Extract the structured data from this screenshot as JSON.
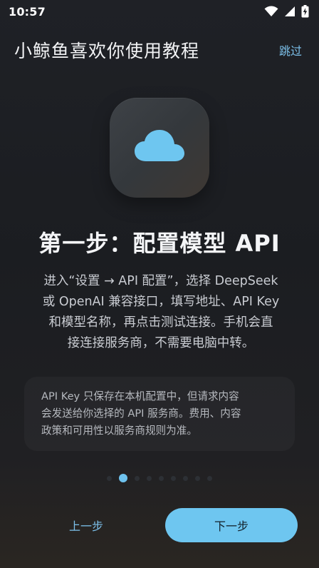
{
  "status_bar": {
    "time": "10:57",
    "icons": [
      "wifi-icon",
      "signal-icon",
      "battery-charging-icon"
    ]
  },
  "header": {
    "title": "小鲸鱼喜欢你使用教程",
    "skip_label": "跳过"
  },
  "hero": {
    "icon": "cloud-icon",
    "icon_color": "#6ec6f0"
  },
  "step": {
    "title": "第一步：配置模型 API",
    "description_lines": [
      "进入“设置 → API 配置”，选择 DeepSeek",
      "或 OpenAI 兼容接口，填写地址、API Key",
      "和模型名称，再点击测试连接。手机会直",
      "接连接服务商，不需要电脑中转。"
    ]
  },
  "notice": {
    "lines": [
      "API Key 只保存在本机配置中，但请求内容",
      "会发送给你选择的 API 服务商。费用、内容",
      "政策和可用性以服务商规则为准。"
    ]
  },
  "pagination": {
    "current_page": 2,
    "total_pages": 9
  },
  "nav": {
    "prev_label": "上一步",
    "next_label": "下一步"
  },
  "colors": {
    "accent": "#6ec6f0",
    "link": "#7cc0ea",
    "background": "#1d1f23"
  }
}
